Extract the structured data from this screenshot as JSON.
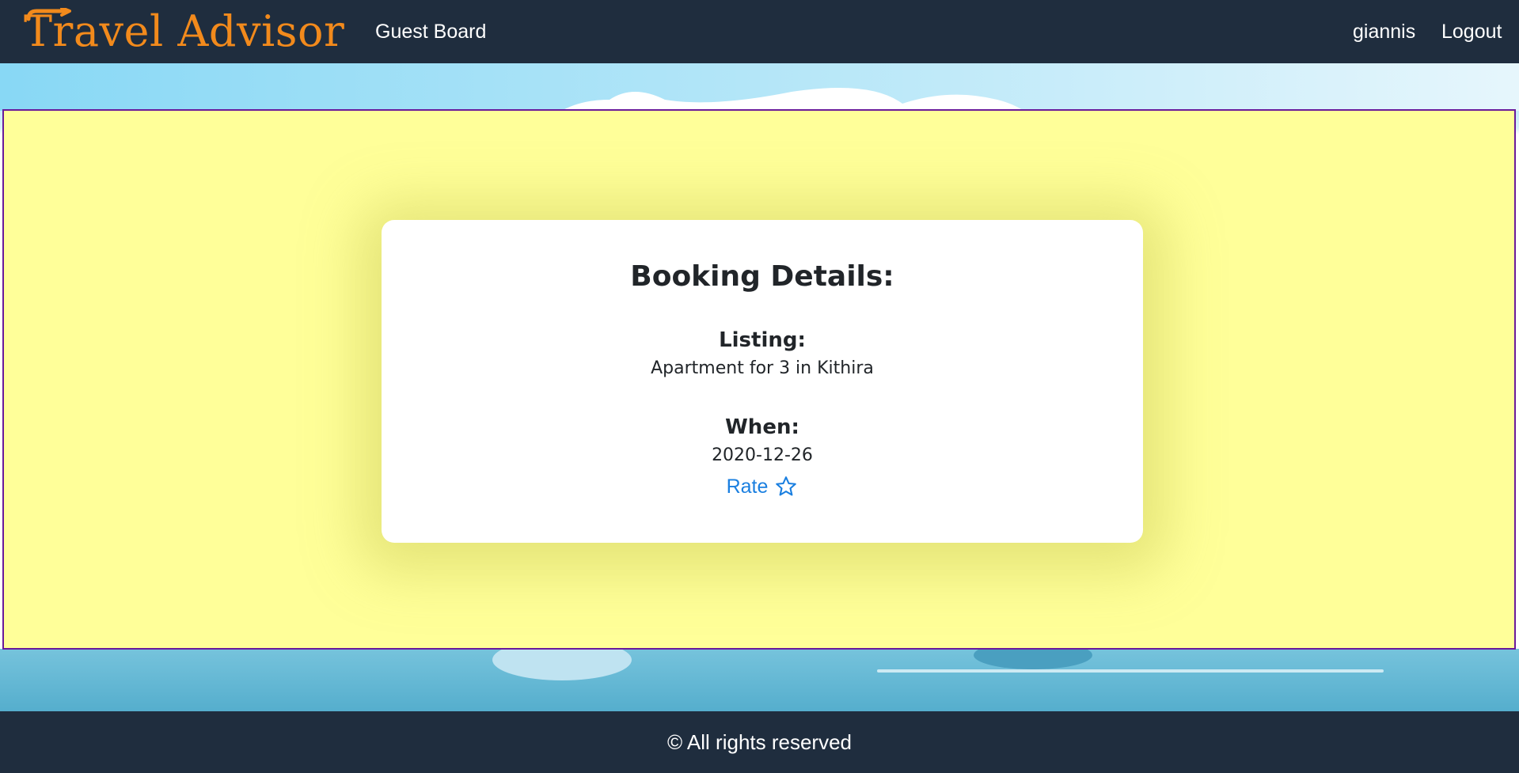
{
  "navbar": {
    "brand": "Travel Advisor",
    "links": {
      "guest_board": "Guest Board",
      "username": "giannis",
      "logout": "Logout"
    }
  },
  "booking": {
    "title": "Booking Details:",
    "listing_label": "Listing:",
    "listing_value": "Apartment for 3 in Kithira",
    "when_label": "When:",
    "when_value": "2020-12-26",
    "rate_label": "Rate",
    "rate_icon": "star-outline-icon"
  },
  "footer": {
    "text": "© All rights reserved"
  },
  "colors": {
    "navbar_bg": "#1f2d3e",
    "brand": "#f28a1c",
    "panel_bg": "#ffff99",
    "panel_border": "#6a1b9a",
    "link_blue": "#1a7fe0"
  }
}
